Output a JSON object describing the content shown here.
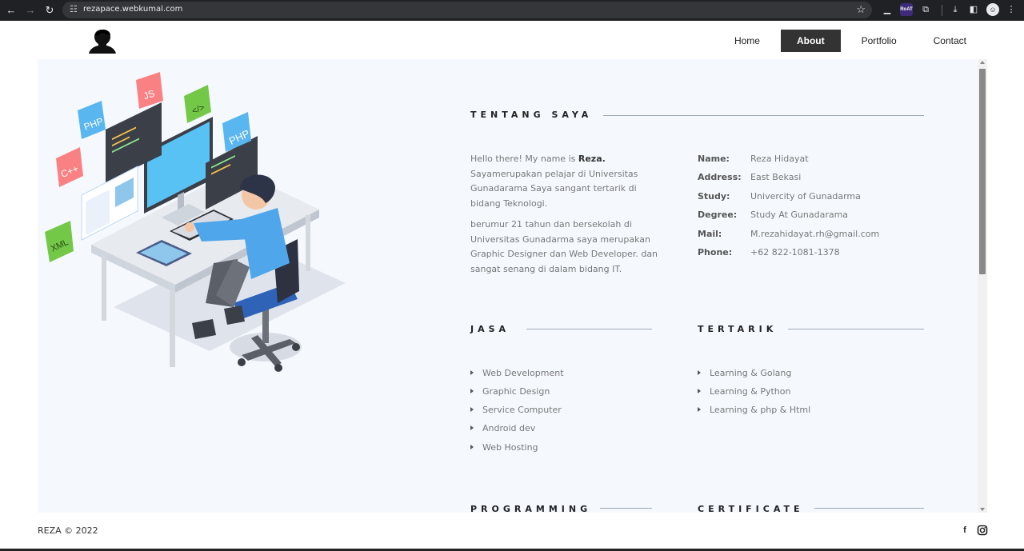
{
  "browser": {
    "url": "rezapace.webkumal.com",
    "ext_badge_label": "RoAT"
  },
  "nav": {
    "items": [
      {
        "label": "Home",
        "active": false
      },
      {
        "label": "About",
        "active": true
      },
      {
        "label": "Portfolio",
        "active": false
      },
      {
        "label": "Contact",
        "active": false
      }
    ]
  },
  "illustration": {
    "tags": [
      "PHP",
      "JS",
      "</>",
      "PHP",
      "C++",
      "XML"
    ]
  },
  "about": {
    "title": "TENTANG SAYA",
    "intro_p1_before": "Hello there! My name is ",
    "intro_p1_name": "Reza.",
    "intro_p1_after": " Sayamerupakan pelajar di Universitas Gunadarama Saya sangant tertarik di bidang Teknologi.",
    "intro_p2": "berumur 21 tahun dan bersekolah di Universitas Gunadarma saya merupakan Graphic Designer dan Web Developer. dan sangat senang di dalam bidang IT."
  },
  "info": [
    {
      "label": "Name:",
      "value": "Reza Hidayat"
    },
    {
      "label": "Address:",
      "value": "East Bekasi"
    },
    {
      "label": "Study:",
      "value": "Univercity of Gunadarma"
    },
    {
      "label": "Degree:",
      "value": "Study At Gunadarama"
    },
    {
      "label": "Mail:",
      "value": "M.rezahidayat.rh@gmail.com"
    },
    {
      "label": "Phone:",
      "value": "+62 822-1081-1378"
    }
  ],
  "jasa": {
    "title": "JASA",
    "items": [
      "Web Development",
      "Graphic Design",
      "Service Computer",
      "Android dev",
      "Web Hosting"
    ]
  },
  "tertarik": {
    "title": "TERTARIK",
    "items": [
      "Learning & Golang",
      "Learning & Python",
      "Learning & php & Html"
    ]
  },
  "programming": {
    "title": "PROGRAMMING"
  },
  "certificate": {
    "title": "CERTIFICATE"
  },
  "footer": {
    "copyright": "REZA © 2022"
  },
  "colors": {
    "active_nav_bg": "#333333",
    "card_bg": "#f5f9fe"
  }
}
